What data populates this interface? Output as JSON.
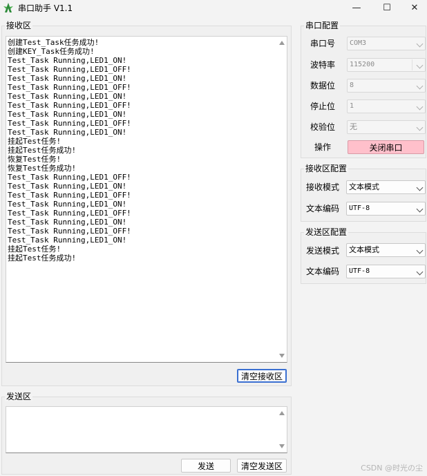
{
  "window": {
    "title": "串口助手 V1.1",
    "minimize": "—",
    "maximize": "☐",
    "close": "✕"
  },
  "receive": {
    "title": "接收区",
    "text": "创建Test_Task任务成功!\n创建KEY_Task任务成功!\nTest_Task Running,LED1_ON!\nTest_Task Running,LED1_OFF!\nTest_Task Running,LED1_ON!\nTest_Task Running,LED1_OFF!\nTest_Task Running,LED1_ON!\nTest_Task Running,LED1_OFF!\nTest_Task Running,LED1_ON!\nTest_Task Running,LED1_OFF!\nTest_Task Running,LED1_ON!\n挂起Test任务!\n挂起Test任务成功!\n恢复Test任务!\n恢复Test任务成功!\nTest_Task Running,LED1_OFF!\nTest_Task Running,LED1_ON!\nTest_Task Running,LED1_OFF!\nTest_Task Running,LED1_ON!\nTest_Task Running,LED1_OFF!\nTest_Task Running,LED1_ON!\nTest_Task Running,LED1_OFF!\nTest_Task Running,LED1_ON!\n挂起Test任务!\n挂起Test任务成功!",
    "clear_button": "清空接收区"
  },
  "send": {
    "title": "发送区",
    "text": "",
    "send_button": "发送",
    "clear_button": "清空发送区"
  },
  "serial_config": {
    "title": "串口配置",
    "port_label": "串口号",
    "port_value": "COM3",
    "baud_label": "波特率",
    "baud_value": "115200",
    "data_bits_label": "数据位",
    "data_bits_value": "8",
    "stop_bits_label": "停止位",
    "stop_bits_value": "1",
    "parity_label": "校验位",
    "parity_value": "无",
    "action_label": "操作",
    "action_button": "关闭串口"
  },
  "recv_config": {
    "title": "接收区配置",
    "mode_label": "接收模式",
    "mode_value": "文本模式",
    "encoding_label": "文本编码",
    "encoding_value": "UTF-8"
  },
  "send_config": {
    "title": "发送区配置",
    "mode_label": "发送模式",
    "mode_value": "文本模式",
    "encoding_label": "文本编码",
    "encoding_value": "UTF-8"
  },
  "watermark": "CSDN @时光の尘",
  "colors": {
    "close_port_button": "#ffc0cb",
    "focus_border": "#3a6fd1",
    "app_icon": "#2e8b3a"
  }
}
